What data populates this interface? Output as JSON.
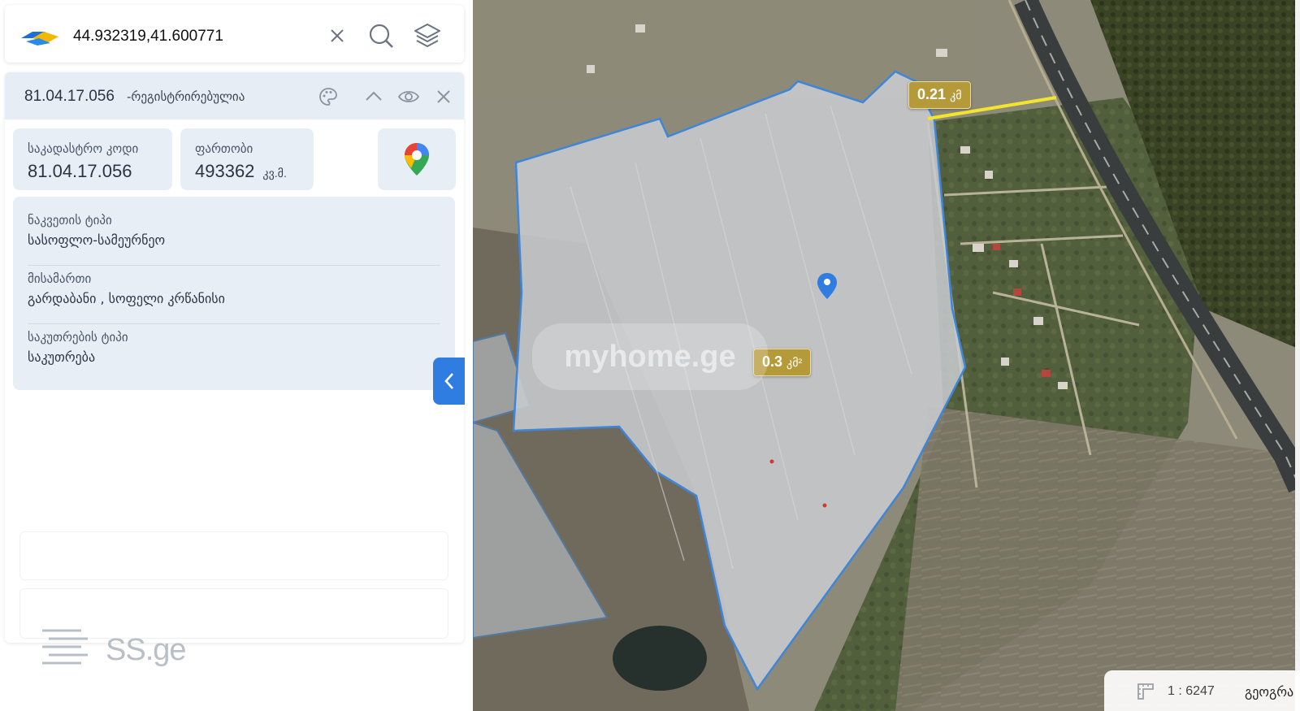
{
  "search": {
    "value": "44.932319,41.600771",
    "clear_icon": "close-icon",
    "search_icon": "search-icon",
    "layers_icon": "layers-icon"
  },
  "parcel": {
    "code": "81.04.17.056",
    "status": "-რეგისტრირებულია",
    "header_icons": [
      "palette-icon",
      "chevron-up-icon",
      "eye-icon",
      "close-icon"
    ],
    "cadastral_label": "საკადასტრო კოდი",
    "cadastral_value": "81.04.17.056",
    "area_label": "ფართობი",
    "area_value": "493362",
    "area_unit": "კვ.მ.",
    "map_pin_icon": "google-maps-pin-icon",
    "fields": [
      {
        "label": "ნაკვეთის ტიპი",
        "value": "სასოფლო-სამეურნეო"
      },
      {
        "label": "მისამართი",
        "value": "გარდაბანი , სოფელი კრწანისი"
      },
      {
        "label": "საკუთრების ტიპი",
        "value": "საკუთრება"
      }
    ]
  },
  "branding": {
    "ss_logo_text": "SS.ge",
    "watermark": "myhome.ge"
  },
  "map": {
    "distance_value": "0.21",
    "distance_unit": "კმ",
    "area_value": "0.3",
    "area_unit": "კმ²",
    "scale": "1 : 6247",
    "language_label": "გეოგრა",
    "parcel_outline_color": "#3f86d8",
    "measure_line_color": "#f3e62a",
    "marker_color": "#2f7de0",
    "badge_color": "#b59a3a"
  },
  "collapse_icon": "chevron-left-icon"
}
